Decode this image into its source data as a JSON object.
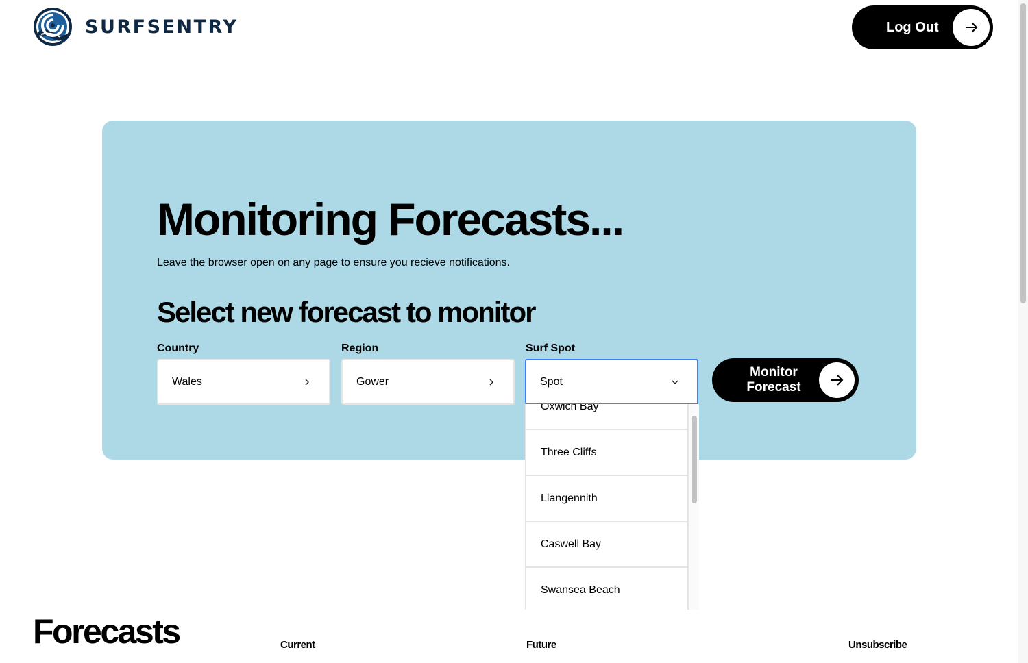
{
  "header": {
    "brand": "SURFSENTRY",
    "logo_icon": "wave-spiral-logo",
    "logout_label": "Log Out",
    "logout_icon": "arrow-right-icon"
  },
  "hero": {
    "title": "Monitoring Forecasts...",
    "subtitle": "Leave the browser open on any page to ensure you recieve notifications.",
    "section_title": "Select new forecast to monitor",
    "colors": {
      "panel_bg": "#add8e6",
      "focus_border": "#3b82f6"
    }
  },
  "form": {
    "country": {
      "label": "Country",
      "value": "Wales",
      "icon": "chevron-right-icon"
    },
    "region": {
      "label": "Region",
      "value": "Gower",
      "icon": "chevron-right-icon"
    },
    "spot": {
      "label": "Surf Spot",
      "value": "Spot",
      "icon": "chevron-down-icon",
      "options": [
        "Oxwich Bay",
        "Three Cliffs",
        "Llangennith",
        "Caswell Bay",
        "Swansea Beach"
      ]
    },
    "submit_label_line1": "Monitor",
    "submit_label_line2": "Forecast"
  },
  "forecasts": {
    "title": "Forecasts",
    "columns": [
      "Current",
      "Future",
      "Unsubscribe"
    ]
  }
}
